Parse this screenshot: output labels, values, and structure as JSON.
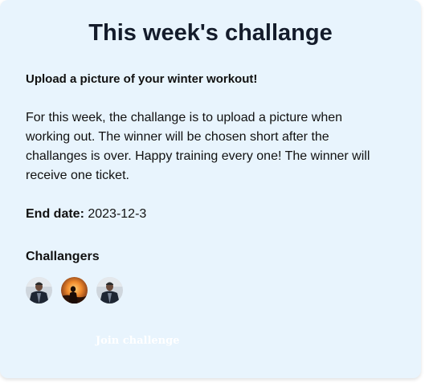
{
  "challenge": {
    "title": "This week's challange",
    "subtitle": "Upload a picture of your winter workout!",
    "description": "For this week, the challange is to upload a picture when working out. The winner will be chosen short after the challanges is over. Happy training every one! The winner will receive one ticket.",
    "end_date_label": "End date:",
    "end_date_value": "2023-12-3",
    "participants_heading": "Challangers",
    "participants": [
      {
        "icon": "avatar-man-jacket"
      },
      {
        "icon": "avatar-sunset-silhouette"
      },
      {
        "icon": "avatar-man-jacket"
      }
    ],
    "join_label": "Join challenge"
  },
  "colors": {
    "card_background": "#e8f4fd",
    "title": "#141c2b",
    "join_text": "#ffffff"
  }
}
